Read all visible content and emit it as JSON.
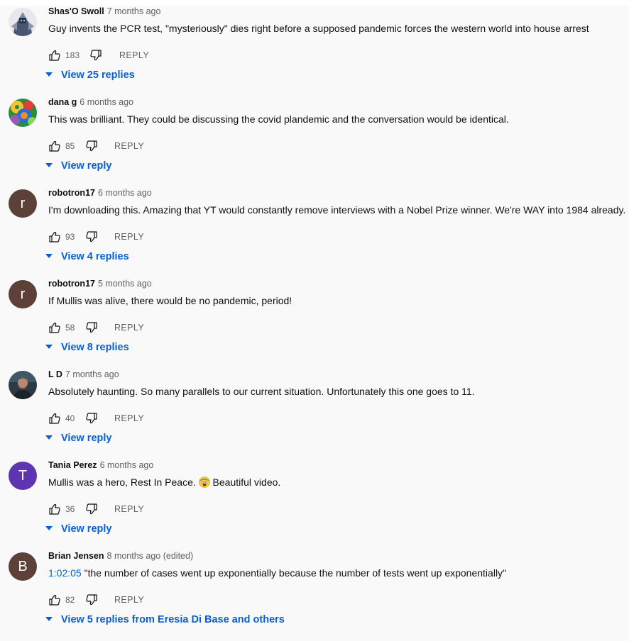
{
  "comments": [
    {
      "author": "Shas'O Swoll",
      "time": "7 months ago",
      "text": "Guy invents the PCR test, \"mysteriously\" dies right before a supposed pandemic forces the western world into house arrest",
      "likes": "183",
      "reply_label": "REPLY",
      "view_replies": "View 25 replies",
      "avatar": {
        "kind": "image",
        "icon": "robot-avatar-icon",
        "color": "#5a6c8a"
      }
    },
    {
      "author": "dana g",
      "time": "6 months ago",
      "text": "This was brilliant. They could be discussing the covid plandemic and the conversation would be identical.",
      "likes": "85",
      "reply_label": "REPLY",
      "view_replies": "View reply",
      "avatar": {
        "kind": "image",
        "icon": "colorful-art-avatar-icon",
        "color": "#3a9a4a"
      }
    },
    {
      "author": "robotron17",
      "time": "6 months ago",
      "text": "I'm downloading this. Amazing that YT would constantly remove interviews with a Nobel Prize winner. We're WAY into 1984 already.",
      "likes": "93",
      "reply_label": "REPLY",
      "view_replies": "View 4 replies",
      "avatar": {
        "kind": "letter",
        "letter": "r",
        "color": "#5d4037"
      }
    },
    {
      "author": "robotron17",
      "time": "5 months ago",
      "text": "If Mullis was alive, there would be no pandemic, period!",
      "likes": "58",
      "reply_label": "REPLY",
      "view_replies": "View 8 replies",
      "avatar": {
        "kind": "letter",
        "letter": "r",
        "color": "#5d4037"
      }
    },
    {
      "author": "L D",
      "time": "7 months ago",
      "text": "Absolutely haunting. So many parallels to our current situation. Unfortunately this one goes to 11.",
      "likes": "40",
      "reply_label": "REPLY",
      "view_replies": "View reply",
      "avatar": {
        "kind": "image",
        "icon": "person-photo-avatar-icon",
        "color": "#2b3a44"
      }
    },
    {
      "author": "Tania Perez",
      "time": "6 months ago",
      "text_before": "Mullis was a hero, Rest In Peace. ",
      "text_after": " Beautiful video.",
      "likes": "36",
      "reply_label": "REPLY",
      "view_replies": "View reply",
      "avatar": {
        "kind": "letter",
        "letter": "T",
        "color": "#5e35b1"
      },
      "emoji": "fearful-face-emoji-icon"
    },
    {
      "author": "Brian Jensen",
      "time": "8 months ago (edited)",
      "timestamp_link": "1:02:05",
      "text_after": " \"the number of cases went up exponentially because the number of tests went up exponentially\"",
      "likes": "82",
      "reply_label": "REPLY",
      "view_replies": "View 5 replies from Eresia Di Base and others",
      "avatar": {
        "kind": "letter",
        "letter": "B",
        "color": "#5d4037"
      }
    }
  ],
  "icons": {
    "like": "thumbs-up-icon",
    "dislike": "thumbs-down-icon",
    "expand": "caret-down-icon"
  },
  "colors": {
    "link": "#065fd4",
    "secondary_text": "#606060",
    "background": "#f9f9f9"
  }
}
